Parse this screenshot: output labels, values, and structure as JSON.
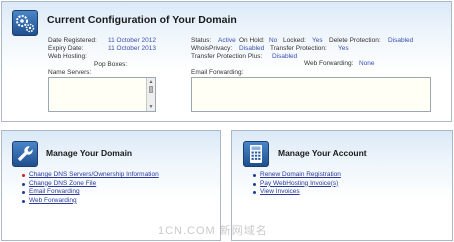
{
  "config": {
    "title": "Current Configuration of Your Domain",
    "date_registered_label": "Date Registered:",
    "date_registered_value": "11 October 2012",
    "expiry_date_label": "Expiry Date:",
    "expiry_date_value": "11 October 2013",
    "web_hosting_label": "Web Hosting:",
    "pop_boxes_label": "Pop Boxes:",
    "name_servers_label": "Name Servers:",
    "status_label": "Status:",
    "status_value": "Active",
    "on_hold_label": "On Hold:",
    "on_hold_value": "No",
    "locked_label": "Locked:",
    "locked_value": "Yes",
    "delete_protection_label": "Delete Protection:",
    "delete_protection_value": "Disabled",
    "whois_privacy_label": "WhoisPrivacy:",
    "whois_privacy_value": "Disabled",
    "transfer_protection_label": "Transfer Protection:",
    "transfer_protection_value": "Yes",
    "transfer_protection_plus_label": "Transfer Protection Plus:",
    "transfer_protection_plus_value": "Disabled",
    "web_forwarding_label": "Web Forwarding:",
    "web_forwarding_value": "None",
    "email_forwarding_label": "Email Forwarding:"
  },
  "manage_domain": {
    "title": "Manage Your Domain",
    "links": [
      "Change DNS Servers/Ownership Information",
      "Change DNS Zone File",
      "Email Forwarding",
      "Web Forwarding"
    ]
  },
  "manage_account": {
    "title": "Manage Your Account",
    "links": [
      "Renew Domain Registration",
      "Pay WebHosting Invoice(s)",
      "View Invoices"
    ]
  },
  "watermark": "1CN.COM 新网域名",
  "colors": {
    "link": "#2a3a9c",
    "value": "#3a4fb0",
    "active_bullet": "#d81b1b",
    "panel_border": "#aab8c8"
  },
  "icons": {
    "config": "gears-icon",
    "domain": "wrench-icon",
    "account": "calculator-icon"
  }
}
